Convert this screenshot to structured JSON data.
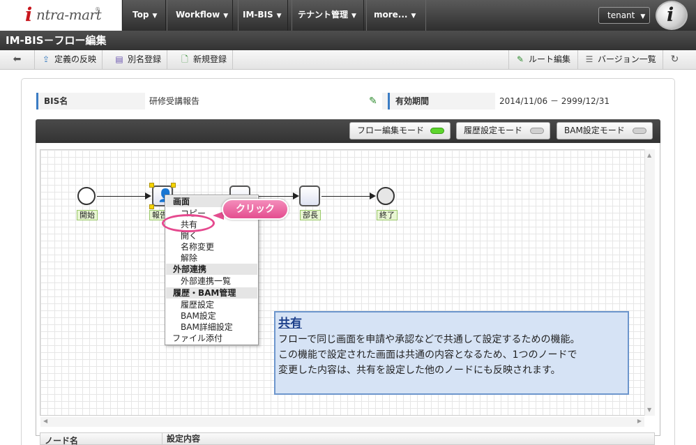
{
  "brand": {
    "logo_initial": "i",
    "logo_text": "ntra-mart",
    "logo_mark": "®"
  },
  "nav": {
    "items": [
      {
        "label": "Top"
      },
      {
        "label": "Workflow"
      },
      {
        "label": "IM-BIS"
      },
      {
        "label": "テナント管理"
      },
      {
        "label": "more..."
      }
    ],
    "caret": "▼",
    "tenant_label": "tenant",
    "user_logo": "i"
  },
  "page": {
    "title": "IM-BIS－フロー編集"
  },
  "toolbar": {
    "back_icon": "arrow-left-icon",
    "apply_label": "定義の反映",
    "alias_label": "別名登録",
    "new_label": "新規登録",
    "route_edit_label": "ルート編集",
    "version_list_label": "バージョン一覧",
    "refresh_icon": "refresh-icon"
  },
  "info": {
    "bis_name_label": "BIS名",
    "bis_name_value": "研修受講報告",
    "period_label": "有効期間",
    "period_value": "2014/11/06 － 2999/12/31"
  },
  "modes": [
    {
      "label": "フロー編集モード",
      "active": true
    },
    {
      "label": "履歴設定モード",
      "active": false
    },
    {
      "label": "BAM設定モード",
      "active": false
    }
  ],
  "flow": {
    "nodes": [
      {
        "label": "開始",
        "kind": "start"
      },
      {
        "label": "報告",
        "kind": "task"
      },
      {
        "label": "",
        "kind": "task"
      },
      {
        "label": "部長",
        "kind": "task"
      },
      {
        "label": "終了",
        "kind": "end"
      }
    ]
  },
  "context_menu": {
    "section1": "画面",
    "copy": "コピー",
    "share": "共有",
    "open": "開く",
    "rename": "名称変更",
    "release": "解除",
    "section2": "外部連携",
    "external_list": "外部連携一覧",
    "section3": "履歴・BAM管理",
    "history": "履歴設定",
    "bam": "BAM設定",
    "bam_detail": "BAM詳細設定",
    "attach": "ファイル添付"
  },
  "callout": {
    "click_label": "クリック"
  },
  "note": {
    "title": "共有",
    "line1": "フローで同じ画面を申請や承認などで共通して設定するための機能。",
    "line2": "この機能で設定された画面は共通の内容となるため、1つのノードで",
    "line3": "変更した内容は、共有を設定した他のノードにも反映されます。"
  },
  "table": {
    "col_node": "ノード名",
    "col_setting": "設定内容"
  },
  "colors": {
    "accent": "#3b7cc4",
    "callout": "#e44d8f",
    "note_bg": "#d6e3f5",
    "mode_on": "#5dd52d"
  }
}
